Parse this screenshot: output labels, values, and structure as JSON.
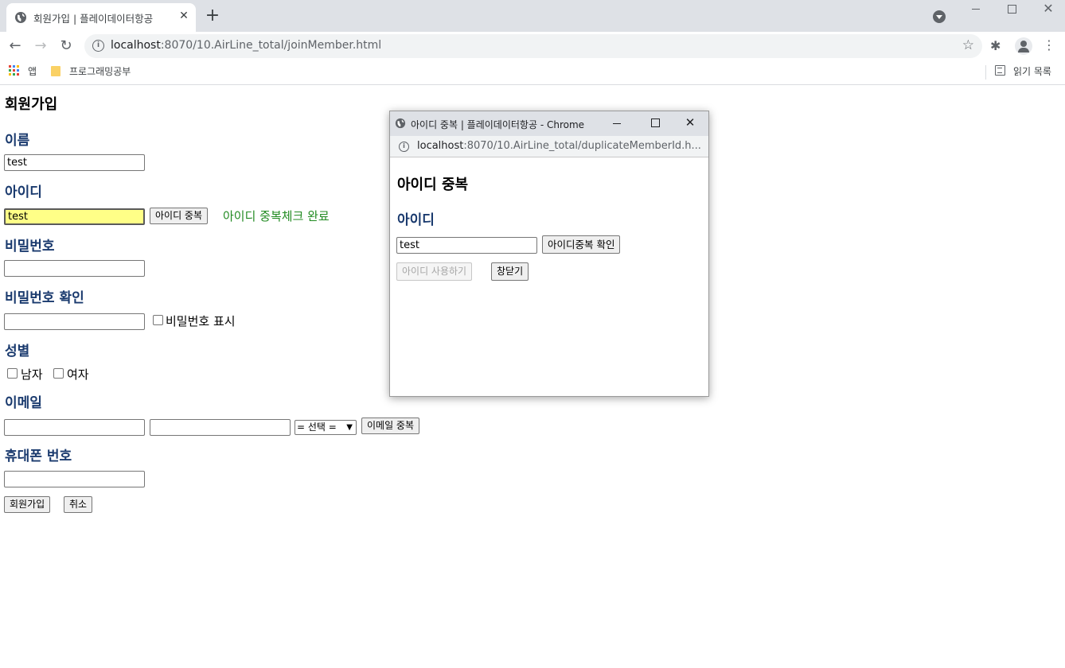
{
  "browser": {
    "tab": {
      "title": "회원가입 | 플레이데이터항공",
      "close": "✕"
    },
    "new_tab": "+",
    "window_close": "✕",
    "nav": {
      "back": "←",
      "forward": "→",
      "reload": "↻"
    },
    "address": {
      "host": "localhost",
      "path": ":8070/10.AirLine_total/joinMember.html"
    },
    "toolbar": {
      "star": "☆",
      "extensions": "✱",
      "menu": "⋮"
    },
    "bookmarks": {
      "apps_label": "앱",
      "folder_label": "프로그래밍공부",
      "reading_list_label": "읽기 목록"
    }
  },
  "form": {
    "title": "회원가입",
    "name_label": "이름",
    "name_value": "test",
    "id_label": "아이디",
    "id_value": "test",
    "id_check_button": "아이디 중복",
    "id_check_status": "아이디 중복체크 완료",
    "password_label": "비밀번호",
    "password_value": "",
    "password_confirm_label": "비밀번호 확인",
    "password_confirm_value": "",
    "show_password_label": "비밀번호 표시",
    "gender_label": "성별",
    "gender_male": "남자",
    "gender_female": "여자",
    "email_label": "이메일",
    "email_local_value": "",
    "email_domain_value": "",
    "email_domain_select": "= 선택 =",
    "email_check_button": "이메일 중복",
    "phone_label": "휴대폰 번호",
    "phone_value": "",
    "submit_button": "회원가입",
    "cancel_button": "취소"
  },
  "popup": {
    "window_title": "아이디 중복 | 플레이데이터항공 - Chrome",
    "close": "✕",
    "address": {
      "host": "localhost",
      "path": ":8070/10.AirLine_total/duplicateMemberId.h..."
    },
    "heading": "아이디 중복",
    "id_label": "아이디",
    "id_value": "test",
    "check_button": "아이디중복 확인",
    "use_button": "아이디 사용하기",
    "close_button": "창닫기"
  },
  "colors": {
    "label": "#1a3a6e",
    "success": "#228b22",
    "highlight_input": "#ffff87",
    "tabstrip": "#dee1e6"
  }
}
